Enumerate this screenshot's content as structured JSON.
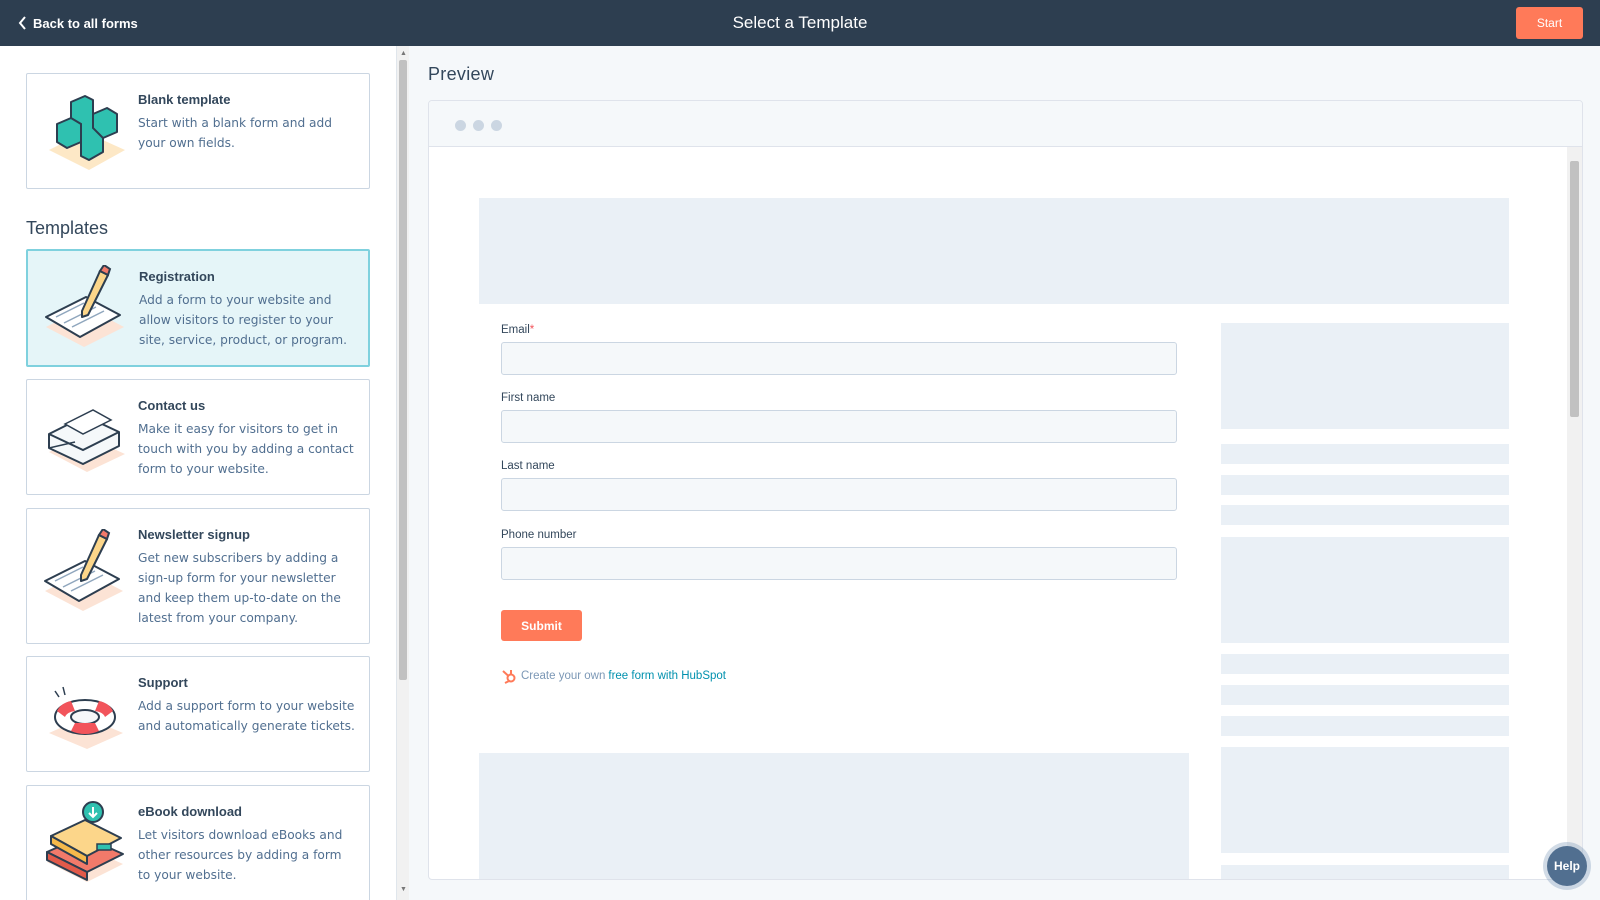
{
  "topbar": {
    "back_label": "Back to all forms",
    "title": "Select a Template",
    "start_label": "Start"
  },
  "blank": {
    "name": "Blank template",
    "desc": "Start with a blank form and add your own fields."
  },
  "templates_heading": "Templates",
  "templates": [
    {
      "name": "Registration",
      "desc": "Add a form to your website and allow visitors to register to your site, service, product, or program.",
      "selected": true
    },
    {
      "name": "Contact us",
      "desc": "Make it easy for visitors to get in touch with you by adding a contact form to your website.",
      "selected": false
    },
    {
      "name": "Newsletter signup",
      "desc": "Get new subscribers by adding a sign-up form for your newsletter and keep them up-to-date on the latest from your company.",
      "selected": false
    },
    {
      "name": "Support",
      "desc": "Add a support form to your website and automatically generate tickets.",
      "selected": false
    },
    {
      "name": "eBook download",
      "desc": "Let visitors download eBooks and other resources by adding a form to your website.",
      "selected": false
    }
  ],
  "preview": {
    "heading": "Preview",
    "fields": [
      {
        "label": "Email",
        "required_mark": "*"
      },
      {
        "label": "First name"
      },
      {
        "label": "Last name"
      },
      {
        "label": "Phone number"
      }
    ],
    "submit_label": "Submit",
    "credit_text": "Create your own",
    "credit_link": "free form with HubSpot"
  },
  "help_label": "Help",
  "colors": {
    "topbar": "#2d3e50",
    "accent": "#ff7a59",
    "selected_bg": "#e5f5f8",
    "selected_border": "#7fd1de",
    "link": "#0091ae"
  },
  "icons": [
    "chevron-left-icon",
    "blank-plus-icon",
    "registration-pencil-icon",
    "contact-envelope-icon",
    "newsletter-pencil-icon",
    "support-lifebuoy-icon",
    "ebook-books-icon",
    "hubspot-sprocket-icon"
  ]
}
